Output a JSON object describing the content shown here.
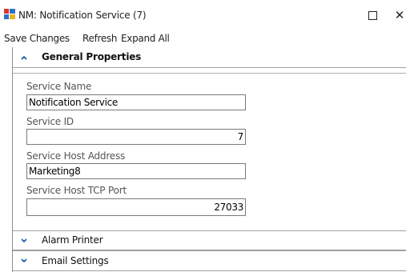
{
  "window": {
    "title": "NM: Notification Service (7)",
    "maximize_icon": "maximize-icon",
    "close_glyph": "✕"
  },
  "menu": {
    "save_label": "Save Changes",
    "refresh_label": "Refresh",
    "expand_label": "Expand All"
  },
  "sections": {
    "general": {
      "label": "General Properties",
      "expanded": true
    },
    "alarm_printer": {
      "label": "Alarm Printer",
      "expanded": false
    },
    "email_settings": {
      "label": "Email Settings",
      "expanded": false
    }
  },
  "fields": {
    "service_name": {
      "label": "Service Name",
      "value": "Notification Service"
    },
    "service_id": {
      "label": "Service ID",
      "value": "7"
    },
    "service_host_address": {
      "label": "Service Host Address",
      "value": "Marketing8"
    },
    "service_host_tcp_port": {
      "label": "Service Host TCP Port",
      "value": "27033"
    }
  },
  "colors": {
    "accent": "#1f5fa8",
    "border": "#7a7a7a"
  }
}
